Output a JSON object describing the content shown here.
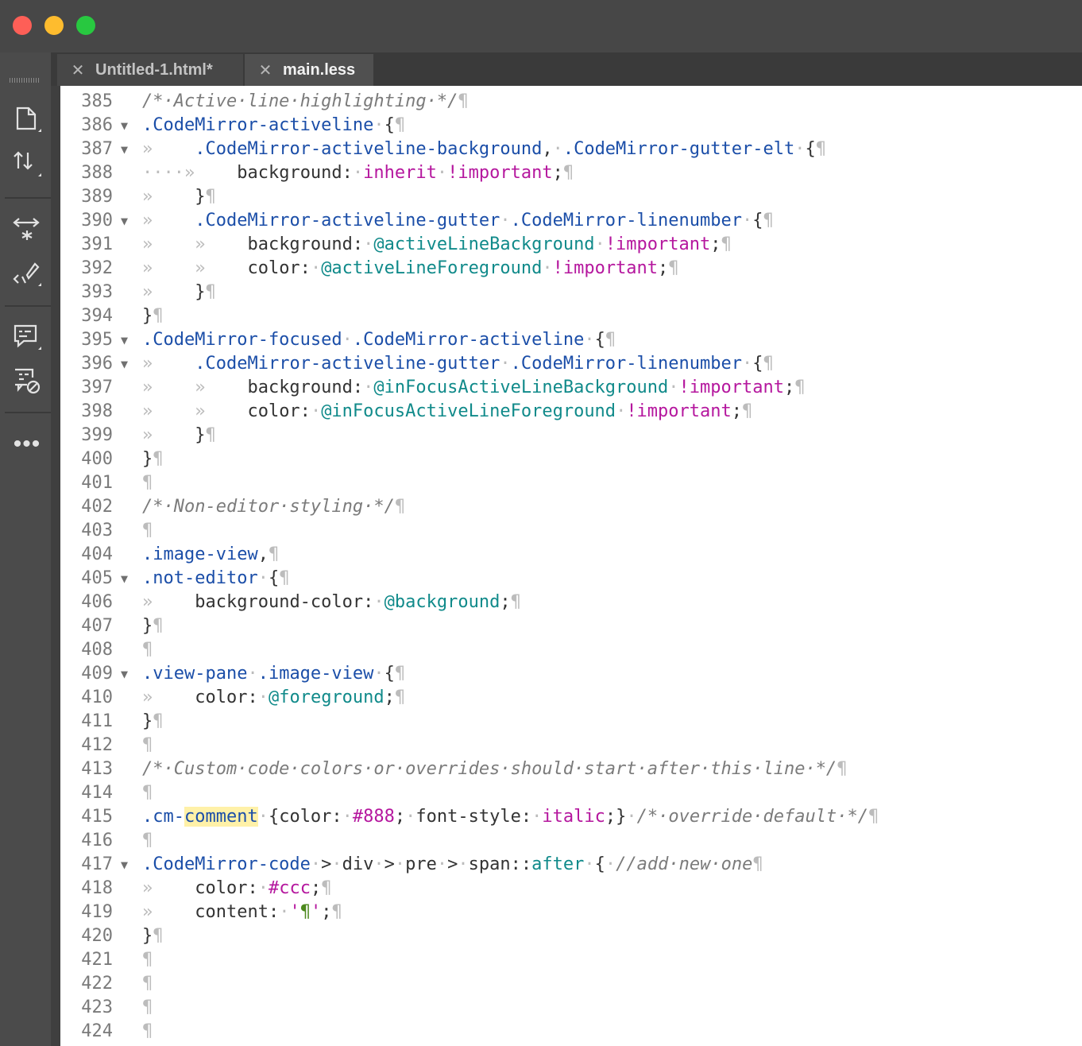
{
  "window": {
    "tabs": [
      {
        "label": "Untitled-1.html*",
        "active": false
      },
      {
        "label": "main.less",
        "active": true
      }
    ],
    "toolbar_icons": [
      "file-icon",
      "sort-arrows-icon",
      "expand-icon",
      "code-brush-icon",
      "comment-icon",
      "comment-disable-icon"
    ],
    "more_label": "•••"
  },
  "editor": {
    "lines": [
      {
        "n": "385",
        "fold": false,
        "tokens": [
          [
            "com",
            "/*·Active·line·highlighting·*/"
          ],
          [
            "inv",
            "¶"
          ]
        ]
      },
      {
        "n": "386",
        "fold": true,
        "tokens": [
          [
            "sel",
            ".CodeMirror-activeline"
          ],
          [
            "inv",
            "·"
          ],
          [
            "plain",
            "{"
          ],
          [
            "inv",
            "¶"
          ]
        ]
      },
      {
        "n": "387",
        "fold": true,
        "tokens": [
          [
            "inv",
            "»    "
          ],
          [
            "sel",
            ".CodeMirror-activeline-background"
          ],
          [
            "plain",
            ","
          ],
          [
            "inv",
            "·"
          ],
          [
            "sel",
            ".CodeMirror-gutter-elt"
          ],
          [
            "inv",
            "·"
          ],
          [
            "plain",
            "{"
          ],
          [
            "inv",
            "¶"
          ]
        ]
      },
      {
        "n": "388",
        "fold": false,
        "tokens": [
          [
            "inv",
            "····»    "
          ],
          [
            "plain",
            "background:"
          ],
          [
            "inv",
            "·"
          ],
          [
            "kw",
            "inherit"
          ],
          [
            "inv",
            "·"
          ],
          [
            "kw",
            "!important"
          ],
          [
            "plain",
            ";"
          ],
          [
            "inv",
            "¶"
          ]
        ]
      },
      {
        "n": "389",
        "fold": false,
        "tokens": [
          [
            "inv",
            "»    "
          ],
          [
            "plain",
            "}"
          ],
          [
            "inv",
            "¶"
          ]
        ]
      },
      {
        "n": "390",
        "fold": true,
        "tokens": [
          [
            "inv",
            "»    "
          ],
          [
            "sel",
            ".CodeMirror-activeline-gutter"
          ],
          [
            "inv",
            "·"
          ],
          [
            "sel",
            ".CodeMirror-linenumber"
          ],
          [
            "inv",
            "·"
          ],
          [
            "plain",
            "{"
          ],
          [
            "inv",
            "¶"
          ]
        ]
      },
      {
        "n": "391",
        "fold": false,
        "tokens": [
          [
            "inv",
            "»    »    "
          ],
          [
            "plain",
            "background:"
          ],
          [
            "inv",
            "·"
          ],
          [
            "var",
            "@activeLineBackground"
          ],
          [
            "inv",
            "·"
          ],
          [
            "kw",
            "!important"
          ],
          [
            "plain",
            ";"
          ],
          [
            "inv",
            "¶"
          ]
        ]
      },
      {
        "n": "392",
        "fold": false,
        "tokens": [
          [
            "inv",
            "»    »    "
          ],
          [
            "plain",
            "color:"
          ],
          [
            "inv",
            "·"
          ],
          [
            "var",
            "@activeLineForeground"
          ],
          [
            "inv",
            "·"
          ],
          [
            "kw",
            "!important"
          ],
          [
            "plain",
            ";"
          ],
          [
            "inv",
            "¶"
          ]
        ]
      },
      {
        "n": "393",
        "fold": false,
        "tokens": [
          [
            "inv",
            "»    "
          ],
          [
            "plain",
            "}"
          ],
          [
            "inv",
            "¶"
          ]
        ]
      },
      {
        "n": "394",
        "fold": false,
        "tokens": [
          [
            "plain",
            "}"
          ],
          [
            "inv",
            "¶"
          ]
        ]
      },
      {
        "n": "395",
        "fold": true,
        "tokens": [
          [
            "sel",
            ".CodeMirror-focused"
          ],
          [
            "inv",
            "·"
          ],
          [
            "sel",
            ".CodeMirror-activeline"
          ],
          [
            "inv",
            "·"
          ],
          [
            "plain",
            "{"
          ],
          [
            "inv",
            "¶"
          ]
        ]
      },
      {
        "n": "396",
        "fold": true,
        "tokens": [
          [
            "inv",
            "»    "
          ],
          [
            "sel",
            ".CodeMirror-activeline-gutter"
          ],
          [
            "inv",
            "·"
          ],
          [
            "sel",
            ".CodeMirror-linenumber"
          ],
          [
            "inv",
            "·"
          ],
          [
            "plain",
            "{"
          ],
          [
            "inv",
            "¶"
          ]
        ]
      },
      {
        "n": "397",
        "fold": false,
        "tokens": [
          [
            "inv",
            "»    »    "
          ],
          [
            "plain",
            "background:"
          ],
          [
            "inv",
            "·"
          ],
          [
            "var",
            "@inFocusActiveLineBackground"
          ],
          [
            "inv",
            "·"
          ],
          [
            "kw",
            "!important"
          ],
          [
            "plain",
            ";"
          ],
          [
            "inv",
            "¶"
          ]
        ]
      },
      {
        "n": "398",
        "fold": false,
        "tokens": [
          [
            "inv",
            "»    »    "
          ],
          [
            "plain",
            "color:"
          ],
          [
            "inv",
            "·"
          ],
          [
            "var",
            "@inFocusActiveLineForeground"
          ],
          [
            "inv",
            "·"
          ],
          [
            "kw",
            "!important"
          ],
          [
            "plain",
            ";"
          ],
          [
            "inv",
            "¶"
          ]
        ]
      },
      {
        "n": "399",
        "fold": false,
        "tokens": [
          [
            "inv",
            "»    "
          ],
          [
            "plain",
            "}"
          ],
          [
            "inv",
            "¶"
          ]
        ]
      },
      {
        "n": "400",
        "fold": false,
        "tokens": [
          [
            "plain",
            "}"
          ],
          [
            "inv",
            "¶"
          ]
        ]
      },
      {
        "n": "401",
        "fold": false,
        "tokens": [
          [
            "inv",
            "¶"
          ]
        ]
      },
      {
        "n": "402",
        "fold": false,
        "tokens": [
          [
            "com",
            "/*·Non-editor·styling·*/"
          ],
          [
            "inv",
            "¶"
          ]
        ]
      },
      {
        "n": "403",
        "fold": false,
        "tokens": [
          [
            "inv",
            "¶"
          ]
        ]
      },
      {
        "n": "404",
        "fold": false,
        "tokens": [
          [
            "sel",
            ".image-view"
          ],
          [
            "plain",
            ","
          ],
          [
            "inv",
            "¶"
          ]
        ]
      },
      {
        "n": "405",
        "fold": true,
        "tokens": [
          [
            "sel",
            ".not-editor"
          ],
          [
            "inv",
            "·"
          ],
          [
            "plain",
            "{"
          ],
          [
            "inv",
            "¶"
          ]
        ]
      },
      {
        "n": "406",
        "fold": false,
        "tokens": [
          [
            "inv",
            "»    "
          ],
          [
            "plain",
            "background-color:"
          ],
          [
            "inv",
            "·"
          ],
          [
            "var",
            "@background"
          ],
          [
            "plain",
            ";"
          ],
          [
            "inv",
            "¶"
          ]
        ]
      },
      {
        "n": "407",
        "fold": false,
        "tokens": [
          [
            "plain",
            "}"
          ],
          [
            "inv",
            "¶"
          ]
        ]
      },
      {
        "n": "408",
        "fold": false,
        "tokens": [
          [
            "inv",
            "¶"
          ]
        ]
      },
      {
        "n": "409",
        "fold": true,
        "tokens": [
          [
            "sel",
            ".view-pane"
          ],
          [
            "inv",
            "·"
          ],
          [
            "sel",
            ".image-view"
          ],
          [
            "inv",
            "·"
          ],
          [
            "plain",
            "{"
          ],
          [
            "inv",
            "¶"
          ]
        ]
      },
      {
        "n": "410",
        "fold": false,
        "tokens": [
          [
            "inv",
            "»    "
          ],
          [
            "plain",
            "color:"
          ],
          [
            "inv",
            "·"
          ],
          [
            "var",
            "@foreground"
          ],
          [
            "plain",
            ";"
          ],
          [
            "inv",
            "¶"
          ]
        ]
      },
      {
        "n": "411",
        "fold": false,
        "tokens": [
          [
            "plain",
            "}"
          ],
          [
            "inv",
            "¶"
          ]
        ]
      },
      {
        "n": "412",
        "fold": false,
        "tokens": [
          [
            "inv",
            "¶"
          ]
        ]
      },
      {
        "n": "413",
        "fold": false,
        "tokens": [
          [
            "com",
            "/*·Custom·code·colors·or·overrides·should·start·after·this·line·*/"
          ],
          [
            "inv",
            "¶"
          ]
        ]
      },
      {
        "n": "414",
        "fold": false,
        "tokens": [
          [
            "inv",
            "¶"
          ]
        ]
      },
      {
        "n": "415",
        "fold": false,
        "tokens": [
          [
            "sel",
            ".cm-"
          ],
          [
            "hl",
            "comment"
          ],
          [
            "inv",
            "·"
          ],
          [
            "plain",
            "{color:"
          ],
          [
            "inv",
            "·"
          ],
          [
            "kw",
            "#888"
          ],
          [
            "plain",
            ";"
          ],
          [
            "inv",
            "·"
          ],
          [
            "plain",
            "font-style:"
          ],
          [
            "inv",
            "·"
          ],
          [
            "kw",
            "italic"
          ],
          [
            "plain",
            ";}"
          ],
          [
            "inv",
            "·"
          ],
          [
            "com",
            "/*·override·default·*/"
          ],
          [
            "inv",
            "¶"
          ]
        ]
      },
      {
        "n": "416",
        "fold": false,
        "tokens": [
          [
            "inv",
            "¶"
          ]
        ]
      },
      {
        "n": "417",
        "fold": true,
        "tokens": [
          [
            "sel",
            ".CodeMirror-code"
          ],
          [
            "inv",
            "·"
          ],
          [
            "plain",
            ">"
          ],
          [
            "inv",
            "·"
          ],
          [
            "plain",
            "div"
          ],
          [
            "inv",
            "·"
          ],
          [
            "plain",
            ">"
          ],
          [
            "inv",
            "·"
          ],
          [
            "plain",
            "pre"
          ],
          [
            "inv",
            "·"
          ],
          [
            "plain",
            ">"
          ],
          [
            "inv",
            "·"
          ],
          [
            "plain",
            "span::"
          ],
          [
            "var",
            "after"
          ],
          [
            "inv",
            "·"
          ],
          [
            "plain",
            "{"
          ],
          [
            "inv",
            "·"
          ],
          [
            "com",
            "//add·new·one"
          ],
          [
            "inv",
            "¶"
          ]
        ]
      },
      {
        "n": "418",
        "fold": false,
        "tokens": [
          [
            "inv",
            "»    "
          ],
          [
            "plain",
            "color:"
          ],
          [
            "inv",
            "·"
          ],
          [
            "kw",
            "#ccc"
          ],
          [
            "plain",
            ";"
          ],
          [
            "inv",
            "¶"
          ]
        ]
      },
      {
        "n": "419",
        "fold": false,
        "tokens": [
          [
            "inv",
            "»    "
          ],
          [
            "plain",
            "content:"
          ],
          [
            "inv",
            "·"
          ],
          [
            "kw",
            "'"
          ],
          [
            "str",
            "¶"
          ],
          [
            "kw",
            "'"
          ],
          [
            "plain",
            ";"
          ],
          [
            "inv",
            "¶"
          ]
        ]
      },
      {
        "n": "420",
        "fold": false,
        "tokens": [
          [
            "plain",
            "}"
          ],
          [
            "inv",
            "¶"
          ]
        ]
      },
      {
        "n": "421",
        "fold": false,
        "tokens": [
          [
            "inv",
            "¶"
          ]
        ]
      },
      {
        "n": "422",
        "fold": false,
        "tokens": [
          [
            "inv",
            "¶"
          ]
        ]
      },
      {
        "n": "423",
        "fold": false,
        "tokens": [
          [
            "inv",
            "¶"
          ]
        ]
      },
      {
        "n": "424",
        "fold": false,
        "tokens": [
          [
            "inv",
            "¶"
          ]
        ]
      }
    ]
  }
}
